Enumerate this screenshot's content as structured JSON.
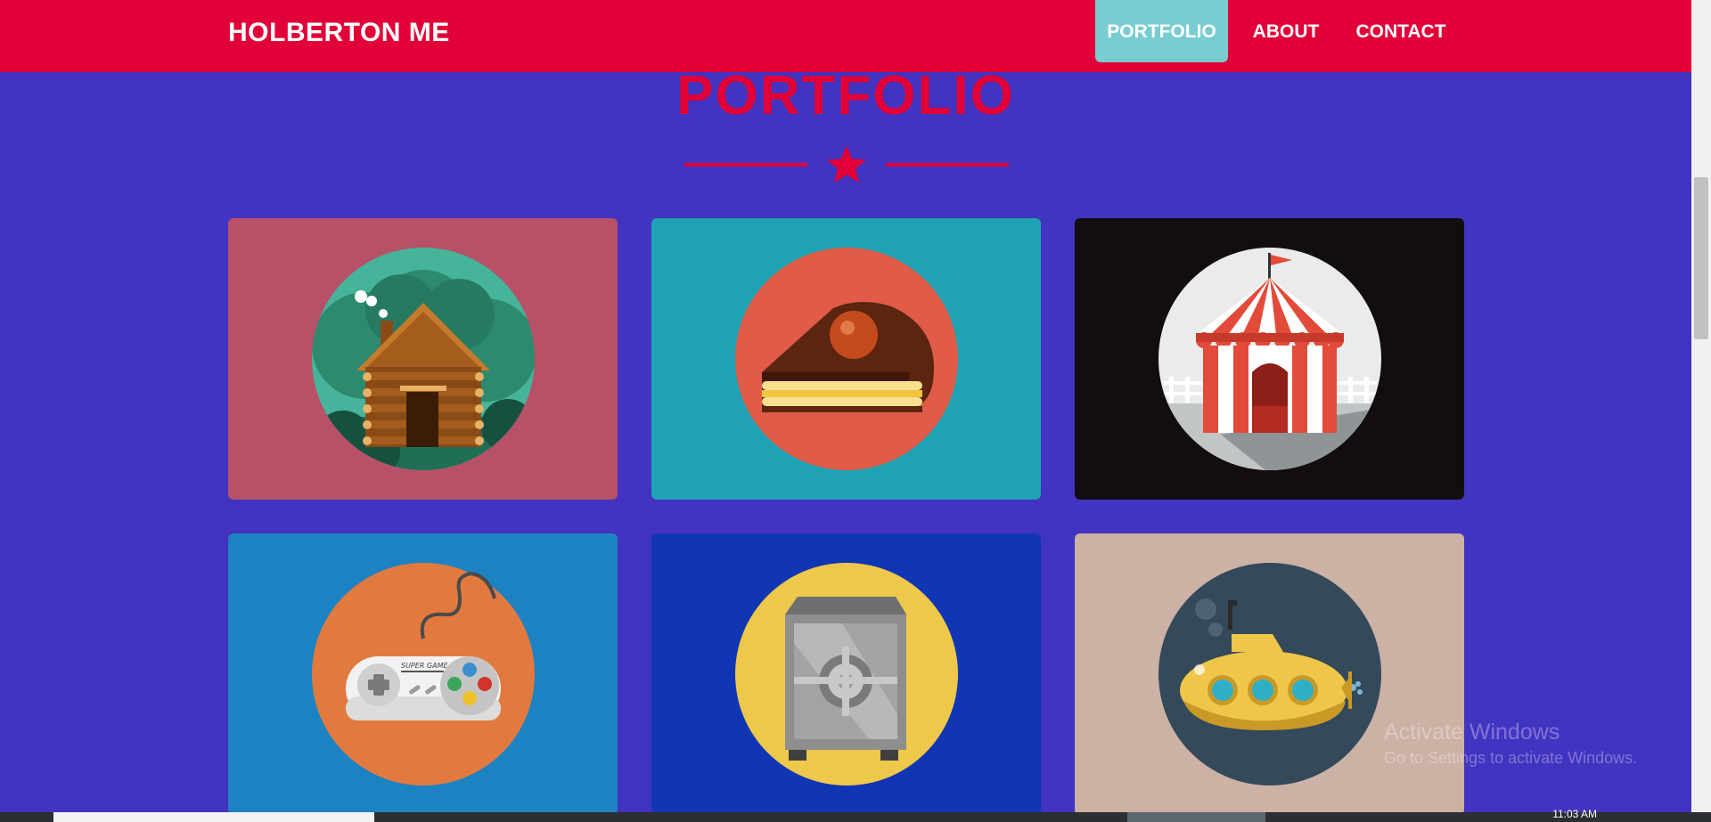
{
  "navbar": {
    "brand": "HOLBERTON ME",
    "links": [
      {
        "label": "PORTFOLIO",
        "active": true
      },
      {
        "label": "ABOUT",
        "active": false
      },
      {
        "label": "CONTACT",
        "active": false
      }
    ]
  },
  "portfolio": {
    "title": "PORTFOLIO",
    "divider_icon": "star-icon",
    "items": [
      {
        "name": "log-cabin-icon",
        "background": "#b75167",
        "circle": "#46b49a"
      },
      {
        "name": "cake-slice-icon",
        "background": "#1fa2b3",
        "circle": "#e05c48"
      },
      {
        "name": "circus-tent-icon",
        "background": "#120e0e",
        "circle": "#eaecec"
      },
      {
        "name": "game-controller-icon",
        "background": "#1d82c2",
        "circle": "#e27a3f"
      },
      {
        "name": "safe-icon",
        "background": "#1136b4",
        "circle": "#eec84a"
      },
      {
        "name": "submarine-icon",
        "background": "#ccb1a5",
        "circle": "#34495a"
      }
    ]
  },
  "watermark": {
    "title": "Activate Windows",
    "subtitle": "Go to Settings to activate Windows."
  },
  "taskbar": {
    "clock": "11:03 AM"
  },
  "colors": {
    "accent": "#e10037",
    "page_background": "#4233c0",
    "active_link": "#78cdd1"
  }
}
